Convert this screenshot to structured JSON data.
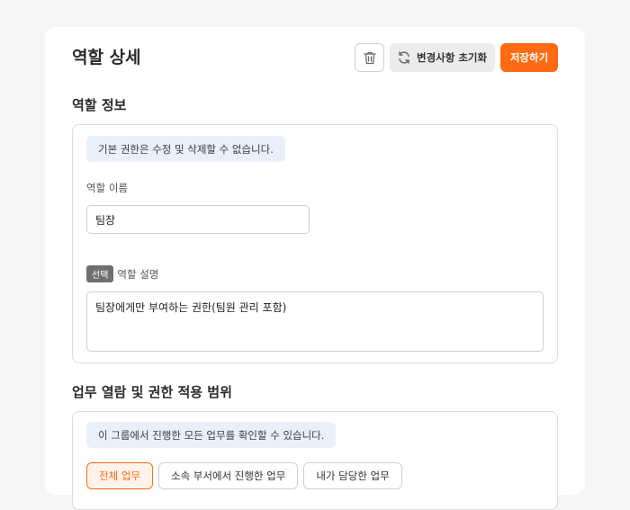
{
  "header": {
    "title": "역할 상세",
    "reset_label": "변경사항 초기화",
    "save_label": "저장하기"
  },
  "role_info": {
    "section_title": "역할 정보",
    "notice": "기본 권한은 수정 및 삭제할 수 없습니다.",
    "name_label": "역할 이름",
    "name_value": "팀장",
    "optional_badge": "선택",
    "description_label": "역할 설명",
    "description_value": "팀장에게만 부여하는 권한(팀원 관리 포함)"
  },
  "scope": {
    "section_title": "업무 열람 및 권한 적용 범위",
    "notice": "이 그룹에서 진행한 모든 업무를 확인할 수 있습니다.",
    "options": [
      {
        "label": "전체 업무",
        "selected": true
      },
      {
        "label": "소속 부서에서 진행한 업무",
        "selected": false
      },
      {
        "label": "내가 담당한 업무",
        "selected": false
      }
    ]
  },
  "colors": {
    "accent": "#ff6a13",
    "notice_bg": "#eaf0fb"
  },
  "icons": {
    "delete": "trash-icon",
    "reset": "refresh-icon"
  }
}
